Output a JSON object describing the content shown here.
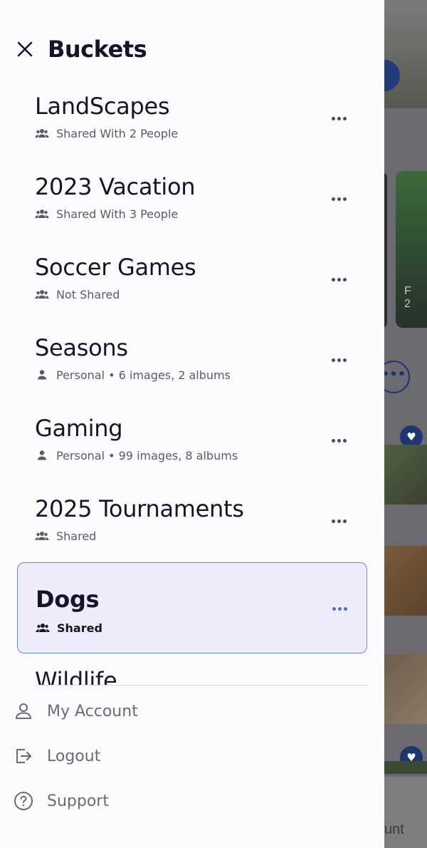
{
  "drawer": {
    "title": "Buckets"
  },
  "buckets": [
    {
      "name": "LandScapes",
      "icon": "people-icon",
      "meta": "Shared With 2 People",
      "selected": false
    },
    {
      "name": "2023 Vacation",
      "icon": "people-icon",
      "meta": "Shared With 3 People",
      "selected": false
    },
    {
      "name": "Soccer Games",
      "icon": "people-icon",
      "meta": "Not Shared",
      "selected": false
    },
    {
      "name": "Seasons",
      "icon": "person-icon",
      "meta": "Personal • 6 images, 2 albums",
      "selected": false
    },
    {
      "name": "Gaming",
      "icon": "person-icon",
      "meta": "Personal • 99 images, 8 albums",
      "selected": false
    },
    {
      "name": "2025 Tournaments",
      "icon": "people-icon",
      "meta": "Shared",
      "selected": false
    },
    {
      "name": "Dogs",
      "icon": "people-icon",
      "meta": "Shared",
      "selected": true
    },
    {
      "name": "Wildlife",
      "icon": "",
      "meta": "",
      "selected": false
    }
  ],
  "footer": {
    "account_label": "My Account",
    "logout_label": "Logout",
    "support_label": "Support"
  },
  "background": {
    "partial_text_1": "F",
    "partial_text_2": "2",
    "partial_text_bottom": "unt"
  },
  "colors": {
    "accent": "#4a6fd0",
    "selected_bg": "#efedfd",
    "title": "#15152a",
    "muted": "#5b5b66"
  }
}
